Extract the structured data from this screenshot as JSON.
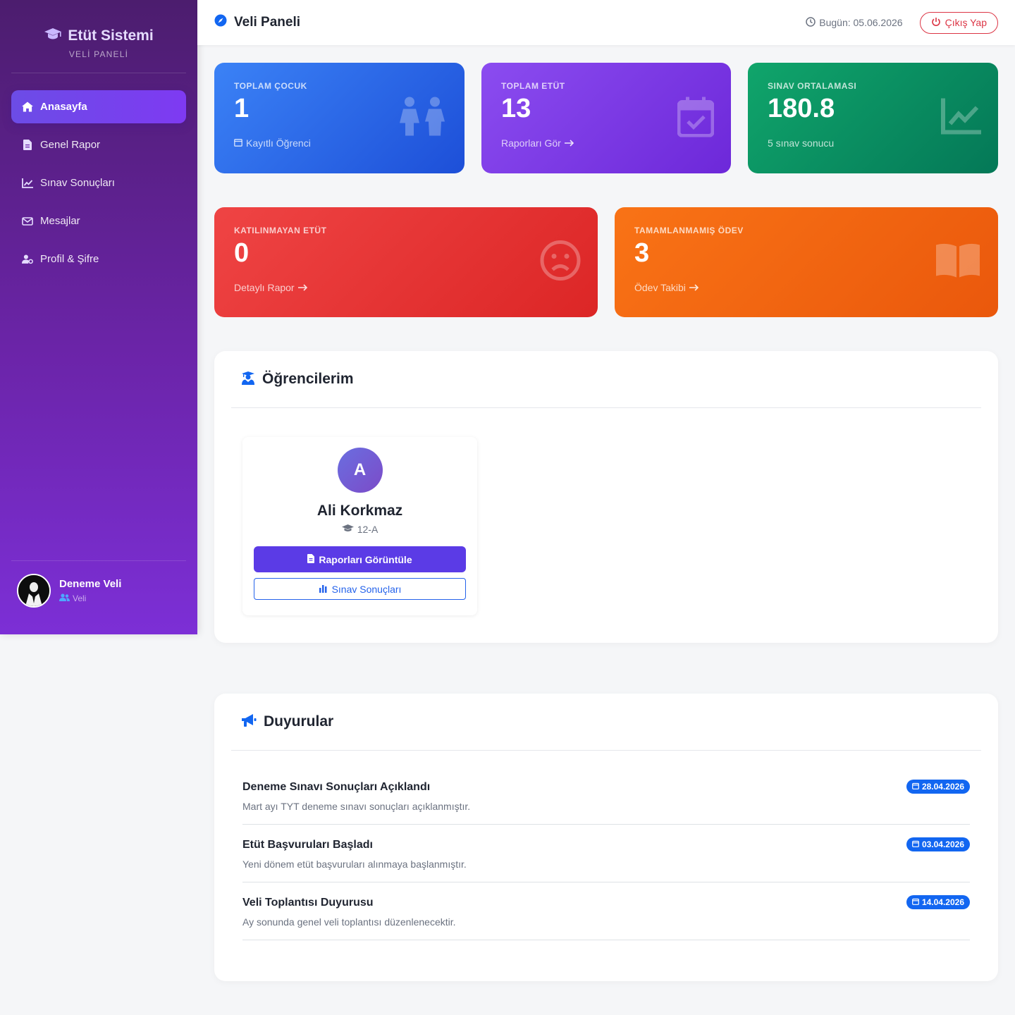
{
  "sidebar": {
    "brand": "Etüt Sistemi",
    "subtitle": "VELİ PANELİ",
    "items": [
      {
        "label": "Anasayfa",
        "icon": "home-icon"
      },
      {
        "label": "Genel Rapor",
        "icon": "file-icon"
      },
      {
        "label": "Sınav Sonuçları",
        "icon": "chart-line-icon"
      },
      {
        "label": "Mesajlar",
        "icon": "envelope-icon"
      },
      {
        "label": "Profil & Şifre",
        "icon": "user-cog-icon"
      }
    ],
    "user": {
      "name": "Deneme Veli",
      "role": "Veli"
    }
  },
  "topbar": {
    "title": "Veli Paneli",
    "today": "Bugün: 05.06.2026",
    "logout": "Çıkış Yap"
  },
  "stats": {
    "children": {
      "label": "TOPLAM ÇOCUK",
      "value": "1",
      "sub": "Kayıtlı Öğrenci"
    },
    "study": {
      "label": "TOPLAM ETÜT",
      "value": "13",
      "sub": "Raporları Gör"
    },
    "exam": {
      "label": "SINAV ORTALAMASI",
      "value": "180.8",
      "sub": "5 sınav sonucu"
    },
    "absent": {
      "label": "KATILINMAYAN ETÜT",
      "value": "0",
      "sub": "Detaylı Rapor"
    },
    "homework": {
      "label": "TAMAMLANMAMIŞ ÖDEV",
      "value": "3",
      "sub": "Ödev Takibi"
    }
  },
  "students": {
    "title": "Öğrencilerim",
    "list": [
      {
        "initial": "A",
        "name": "Ali Korkmaz",
        "class": "12-A",
        "reports_btn": "Raporları Görüntüle",
        "exams_btn": "Sınav Sonuçları"
      }
    ]
  },
  "announcements": {
    "title": "Duyurular",
    "items": [
      {
        "title": "Deneme Sınavı Sonuçları Açıklandı",
        "text": "Mart ayı TYT deneme sınavı sonuçları açıklanmıştır.",
        "date": "28.04.2026"
      },
      {
        "title": "Etüt Başvuruları Başladı",
        "text": "Yeni dönem etüt başvuruları alınmaya başlanmıştır.",
        "date": "03.04.2026"
      },
      {
        "title": "Veli Toplantısı Duyurusu",
        "text": "Ay sonunda genel veli toplantısı düzenlenecektir.",
        "date": "14.04.2026"
      }
    ]
  },
  "colors": {
    "accent": "#7e3af2",
    "blue_card": "#2563eb",
    "purple_card": "#7c3aed",
    "green_card": "#059669",
    "red_card": "#dc2626",
    "orange_card": "#ea580c",
    "badge": "#1266f1"
  }
}
